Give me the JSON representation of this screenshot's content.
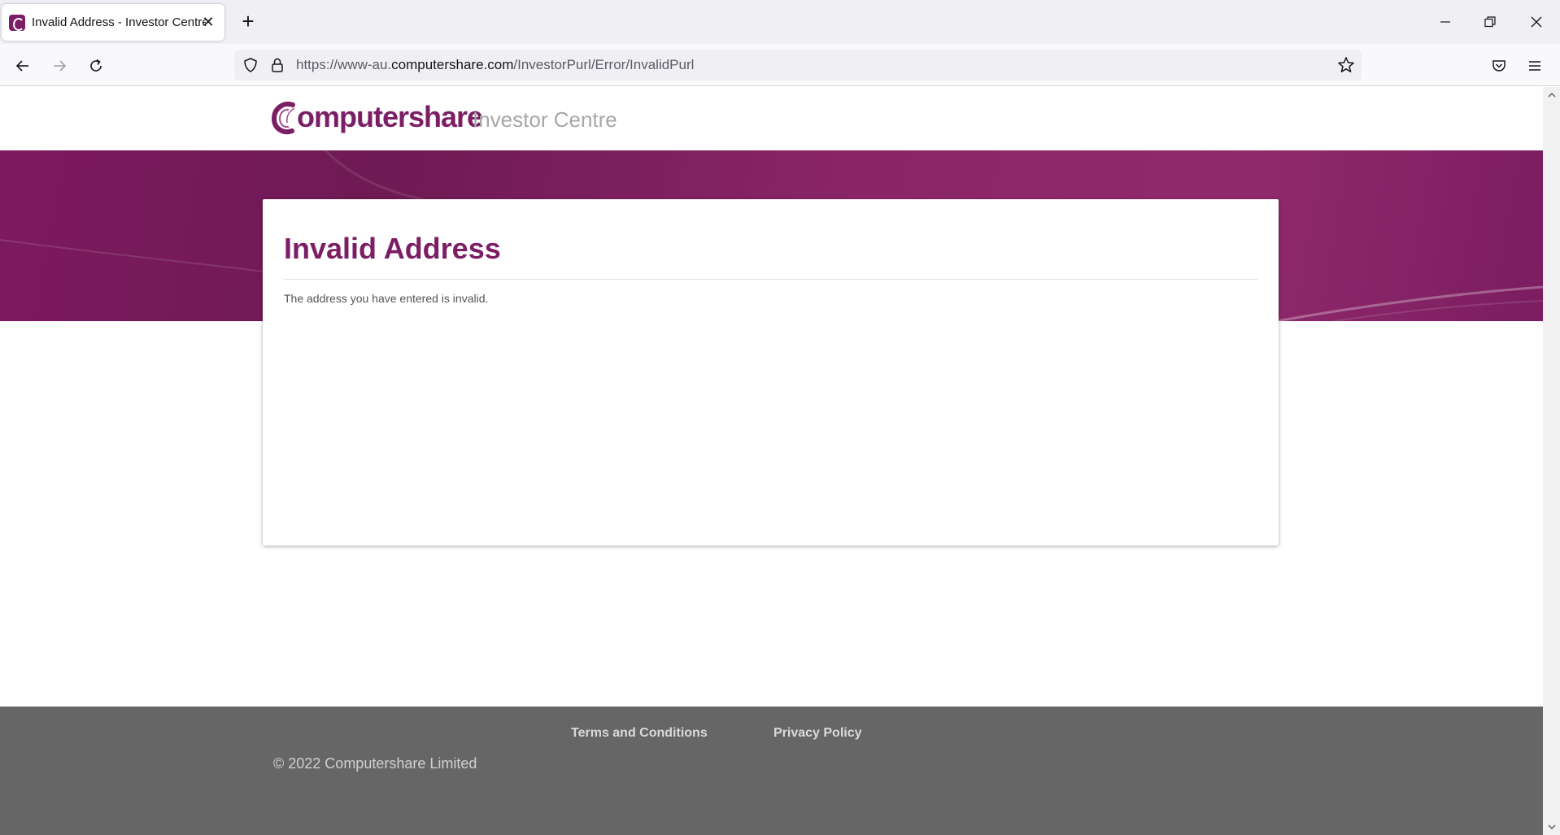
{
  "browser": {
    "tab_title": "Invalid Address - Investor Centre",
    "url_prefix": "https://www-au.",
    "url_host": "computershare.com",
    "url_path": "/InvestorPurl/Error/InvalidPurl"
  },
  "header": {
    "logo_text": "omputershare",
    "product": "Investor Centre"
  },
  "card": {
    "title": "Invalid Address",
    "message": "The address you have entered is invalid."
  },
  "footer": {
    "links": [
      "Terms and Conditions",
      "Privacy Policy"
    ],
    "copyright": "© 2022 Computershare Limited"
  },
  "colors": {
    "brand": "#7b1e66",
    "footer_bg": "#666666"
  }
}
